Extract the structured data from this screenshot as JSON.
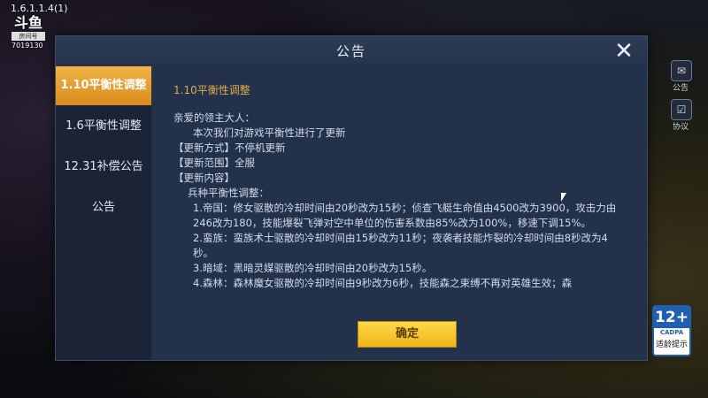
{
  "overlay": {
    "version": "1.6.1.1.4(1)",
    "logo_text": "斗鱼",
    "logo_sub": "房间号",
    "room_id": "7019130"
  },
  "side": {
    "mail_label": "公告",
    "agreement_label": "协议"
  },
  "dialog": {
    "title": "公告",
    "tabs": [
      {
        "label": "1.10平衡性调整",
        "active": true
      },
      {
        "label": "1.6平衡性调整",
        "active": false
      },
      {
        "label": "12.31补偿公告",
        "active": false
      },
      {
        "label": "公告",
        "active": false
      }
    ],
    "content_title": "1.10平衡性调整",
    "lines": [
      "亲爱的领主大人：",
      "本次我们对游戏平衡性进行了更新",
      "【更新方式】不停机更新",
      "【更新范围】全服",
      "【更新内容】",
      "兵种平衡性调整：",
      "1.帝国：修女驱散的冷却时间由20秒改为15秒；侦查飞艇生命值由4500改为3900，攻击力由246改为180，技能爆裂飞弹对空中单位的伤害系数由85%改为100%，移速下调15%。",
      "2.蛮族：蛮族术士驱散的冷却时间由15秒改为11秒；夜袭者技能炸裂的冷却时间由8秒改为4秒。",
      "3.暗域：黑暗灵媒驱散的冷却时间由20秒改为15秒。",
      "4.森林：森林魔女驱散的冷却时间由9秒改为6秒，技能森之束缚不再对英雄生效；森"
    ],
    "confirm_label": "确定"
  },
  "age_rating": {
    "age": "12+",
    "org": "CADPA",
    "tip": "适龄提示"
  },
  "colors": {
    "accent_tab": "#e8a030",
    "confirm": "#f5c21f",
    "title_orange": "#e5a94a"
  }
}
